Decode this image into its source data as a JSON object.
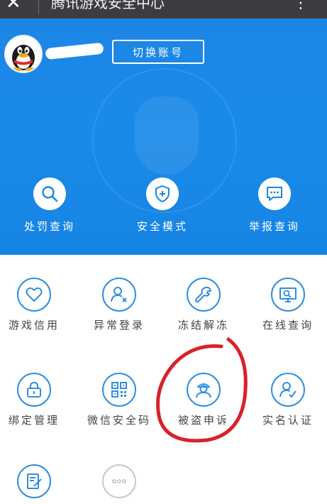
{
  "top_bar": {
    "back_glyph": "✕",
    "title": "腾讯游戏安全中心",
    "more_glyph": "⋮",
    "background": "#3b3d40"
  },
  "header": {
    "switch_account_label": "切换账号",
    "background": "#1a87e6",
    "quick_actions": [
      {
        "label": "处罚查询",
        "icon": "search-icon"
      },
      {
        "label": "安全模式",
        "icon": "shield-plus-icon"
      },
      {
        "label": "举报查询",
        "icon": "chat-icon"
      }
    ]
  },
  "services": [
    {
      "label": "游戏信用",
      "icon": "heart-icon"
    },
    {
      "label": "异常登录",
      "icon": "user-x-icon"
    },
    {
      "label": "冻结解冻",
      "icon": "wrench-icon"
    },
    {
      "label": "在线查询",
      "icon": "monitor-search-icon"
    },
    {
      "label": "绑定管理",
      "icon": "lock-icon"
    },
    {
      "label": "微信安全码",
      "icon": "qrcode-icon"
    },
    {
      "label": "被盗申诉",
      "icon": "thief-icon"
    },
    {
      "label": "实名认证",
      "icon": "user-check-icon"
    },
    {
      "label": "",
      "icon": "document-edit-icon"
    },
    {
      "label": "",
      "icon": "more-dots-icon"
    }
  ],
  "accent_color": "#2f8fe0",
  "annotation_color": "#d8222a"
}
